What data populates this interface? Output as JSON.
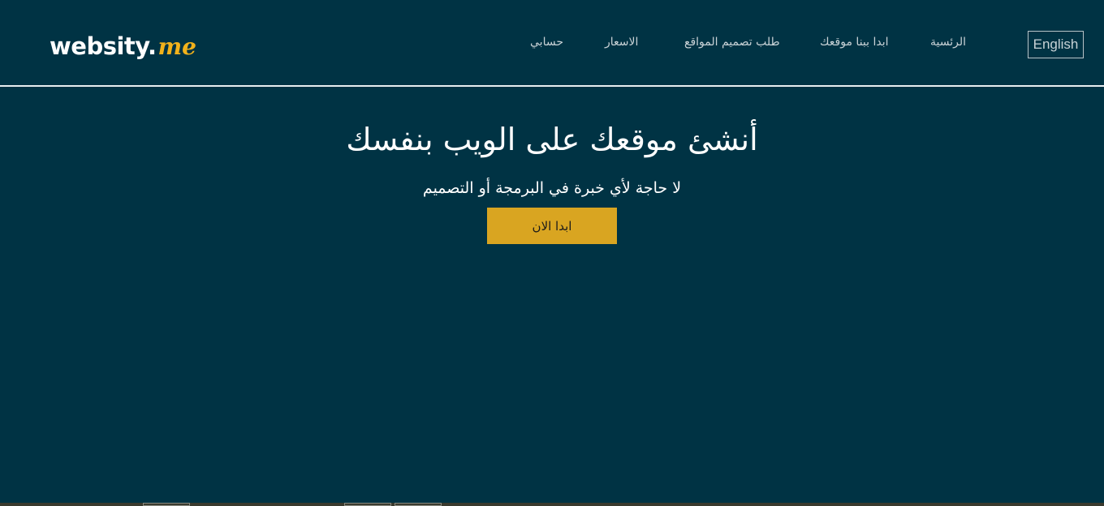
{
  "header": {
    "logo_main": "websity.",
    "logo_accent": "me",
    "nav": [
      {
        "label": "الرئسية"
      },
      {
        "label": "ابدا ببنا موقعك"
      },
      {
        "label": "طلب تصميم المواقع"
      },
      {
        "label": "الاسعار"
      },
      {
        "label": "حسابي"
      }
    ],
    "language_button": "English"
  },
  "hero": {
    "title": "أنشئ موقعك على الويب بنفسك",
    "subtitle": "لا حاجة لأي خبرة في البرمجة أو التصميم",
    "cta_label": "ابدا الان"
  },
  "colors": {
    "background": "#003344",
    "accent": "#d9a521",
    "logo_accent": "#f2b21b"
  }
}
